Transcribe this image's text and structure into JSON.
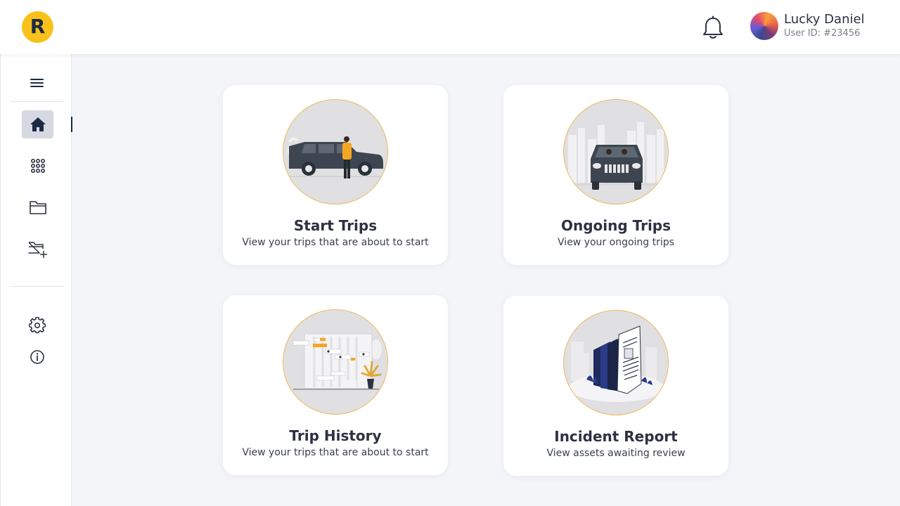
{
  "header": {
    "logo_letter": "R",
    "user": {
      "name": "Lucky Daniel",
      "id": "User ID: #23456"
    }
  },
  "sidebar": {
    "items": [
      {
        "name": "menu",
        "icon": "hamburger-menu-icon"
      },
      {
        "name": "home",
        "icon": "home-icon",
        "active": true
      },
      {
        "name": "apps",
        "icon": "grid-dots-icon"
      },
      {
        "name": "folder",
        "icon": "folder-icon"
      },
      {
        "name": "add-folder",
        "icon": "folder-plus-icon"
      },
      {
        "name": "settings",
        "icon": "gear-icon"
      },
      {
        "name": "info",
        "icon": "info-icon"
      }
    ]
  },
  "cards": [
    {
      "title": "Start Trips",
      "subtitle": "View your trips that are about to start",
      "icon": "car-with-driver-illustration"
    },
    {
      "title": "Ongoing Trips",
      "subtitle": "View your ongoing trips",
      "icon": "suv-front-city-illustration"
    },
    {
      "title": "Trip History",
      "subtitle": "View your trips that are about to start",
      "icon": "gantt-chart-history-illustration"
    },
    {
      "title": "Incident Report",
      "subtitle": "View assets awaiting review",
      "icon": "documents-report-illustration"
    }
  ],
  "colors": {
    "accent_yellow": "#f9c21a",
    "navy": "#1e2a44",
    "background": "#f4f5f9",
    "card_circle_border": "#efb85a"
  }
}
